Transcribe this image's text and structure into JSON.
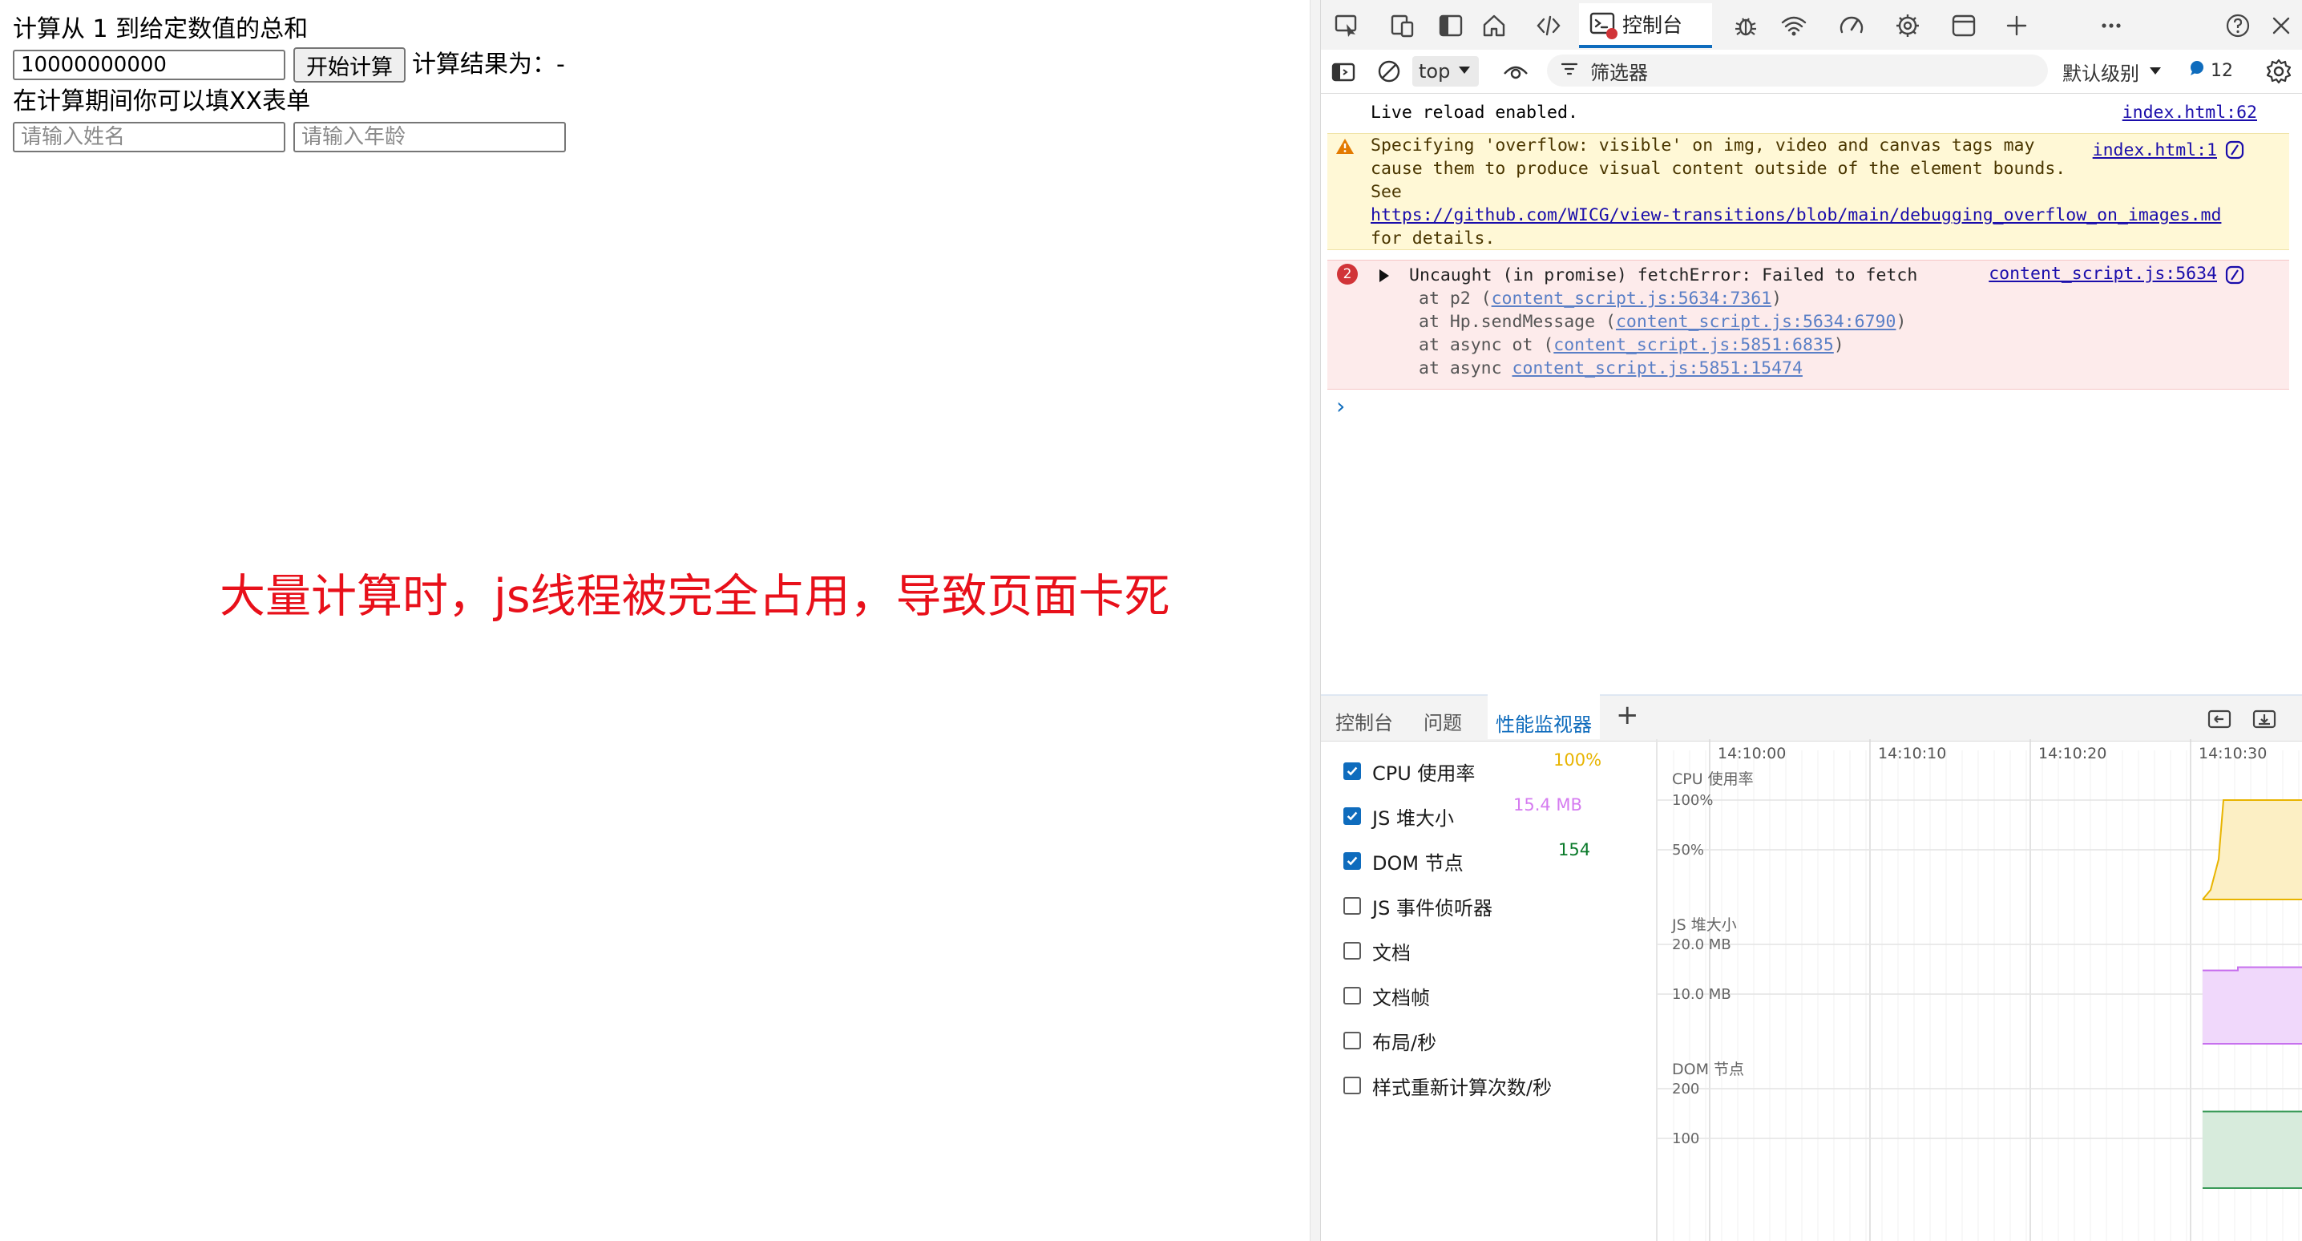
{
  "page": {
    "title_line": "计算从 1 到给定数值的总和",
    "number_input_value": "10000000000",
    "start_button": "开始计算",
    "result_label": "计算结果为：-",
    "form_note": "在计算期间你可以填XX表单",
    "name_placeholder": "请输入姓名",
    "age_placeholder": "请输入年龄",
    "big_note": "大量计算时，js线程被完全占用，导致页面卡死",
    "big_note_color": "#e8101a"
  },
  "devtools": {
    "active_tab": "控制台",
    "context": "top",
    "filter_placeholder": "筛选器",
    "level": "默认级别",
    "message_count": "12",
    "accent_color": "#0f6cbd",
    "messages": {
      "live_reload": {
        "text": "Live reload enabled.",
        "source": "index.html:62"
      },
      "warning": {
        "line1": "Specifying 'overflow: visible' on img, video and canvas tags may",
        "line2": "cause them to produce visual content outside of the element bounds.",
        "line3": "See",
        "url": "https://github.com/WICG/view-transitions/blob/main/debugging_overflow_on_images.md",
        "line5": "for details.",
        "source": "index.html:1"
      },
      "error": {
        "count": "2",
        "text": "Uncaught (in promise) fetchError: Failed to fetch",
        "source": "content_script.js:5634",
        "stack": [
          {
            "prefix": "at p2 (",
            "link": "content_script.js:5634:7361",
            "suffix": ")"
          },
          {
            "prefix": "at Hp.sendMessage (",
            "link": "content_script.js:5634:6790",
            "suffix": ")"
          },
          {
            "prefix": "at async ot (",
            "link": "content_script.js:5851:6835",
            "suffix": ")"
          },
          {
            "prefix": "at async ",
            "link": "content_script.js:5851:15474",
            "suffix": ""
          }
        ]
      },
      "prompt": "›"
    },
    "drawer": {
      "tabs": [
        "控制台",
        "问题",
        "性能监视器"
      ],
      "add": "+",
      "metrics": [
        {
          "label": "CPU 使用率",
          "checked": true,
          "value": "100%",
          "color": "#e8b400"
        },
        {
          "label": "JS 堆大小",
          "checked": true,
          "value": "15.4 MB",
          "color": "#d57bf0"
        },
        {
          "label": "DOM 节点",
          "checked": true,
          "value": "154",
          "color": "#0a7a2a"
        },
        {
          "label": "JS 事件侦听器",
          "checked": false,
          "value": "",
          "color": ""
        },
        {
          "label": "文档",
          "checked": false,
          "value": "",
          "color": ""
        },
        {
          "label": "文档帧",
          "checked": false,
          "value": "",
          "color": ""
        },
        {
          "label": "布局/秒",
          "checked": false,
          "value": "",
          "color": ""
        },
        {
          "label": "样式重新计算次数/秒",
          "checked": false,
          "value": "",
          "color": ""
        }
      ],
      "time_ticks": [
        "14:10:00",
        "14:10:10",
        "14:10:20",
        "14:10:30"
      ],
      "charts": {
        "cpu": {
          "title": "CPU 使用率",
          "ticks": [
            "100%",
            "50%"
          ],
          "current": 100
        },
        "heap": {
          "title": "JS 堆大小",
          "ticks": [
            "20.0 MB",
            "10.0 MB"
          ],
          "current": 15.4
        },
        "dom": {
          "title": "DOM 节点",
          "ticks": [
            "200",
            "100"
          ],
          "current": 154
        }
      }
    }
  }
}
